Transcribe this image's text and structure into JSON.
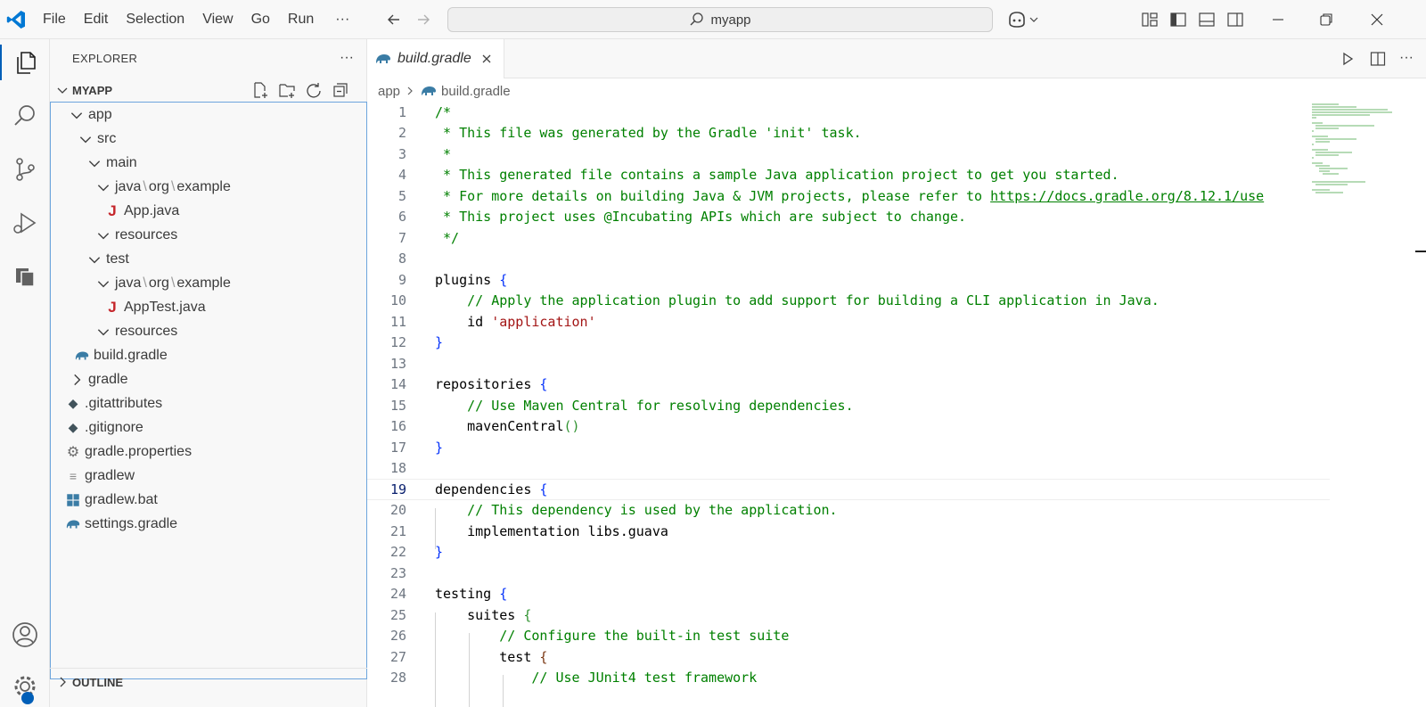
{
  "titlebar": {
    "menu": [
      "File",
      "Edit",
      "Selection",
      "View",
      "Go",
      "Run",
      "···"
    ],
    "search_text": "myapp",
    "icons": [
      "vscode-logo-icon",
      "arrow-left-icon",
      "arrow-right-icon",
      "search-icon",
      "copilot-icon",
      "customize-layout-icon",
      "toggle-sidebar-icon",
      "toggle-panel-icon",
      "toggle-secondary-sidebar-icon",
      "minimize-icon",
      "restore-icon",
      "close-icon"
    ],
    "accent": "#005fb8"
  },
  "activity_bar": {
    "items": [
      "explorer-icon",
      "search-icon",
      "source-control-icon",
      "run-debug-icon",
      "remote-explorer-icon",
      "accounts-icon",
      "manage-gear-icon"
    ]
  },
  "sidebar": {
    "title": "EXPLORER",
    "more": "···",
    "section": "MYAPP",
    "tree": [
      {
        "label": "app",
        "type": "folder-open"
      },
      {
        "label": "src",
        "type": "folder-open"
      },
      {
        "label": "main",
        "type": "folder-open"
      },
      {
        "label": "java",
        "label2": "org",
        "label3": "example",
        "type": "folder-open"
      },
      {
        "label": "App.java",
        "type": "java"
      },
      {
        "label": "resources",
        "type": "folder-open"
      },
      {
        "label": "test",
        "type": "folder-open"
      },
      {
        "label": "java",
        "label2": "org",
        "label3": "example",
        "type": "folder-open"
      },
      {
        "label": "AppTest.java",
        "type": "java"
      },
      {
        "label": "resources",
        "type": "folder-open"
      },
      {
        "label": "build.gradle",
        "type": "gradle"
      },
      {
        "label": "gradle",
        "type": "folder-closed"
      },
      {
        "label": ".gitattributes",
        "type": "git"
      },
      {
        "label": ".gitignore",
        "type": "git"
      },
      {
        "label": "gradle.properties",
        "type": "gear"
      },
      {
        "label": "gradlew",
        "type": "text"
      },
      {
        "label": "gradlew.bat",
        "type": "windows"
      },
      {
        "label": "settings.gradle",
        "type": "gradle"
      }
    ],
    "outline": "OUTLINE"
  },
  "editor": {
    "tab": "build.gradle",
    "breadcrumb": [
      "app",
      "build.gradle"
    ],
    "current_line": 19,
    "code": [
      {
        "n": "1",
        "t": "/*"
      },
      {
        "n": "2",
        "t": " * This file was generated by the Gradle 'init' task."
      },
      {
        "n": "3",
        "t": " *"
      },
      {
        "n": "4",
        "t": " * This generated file contains a sample Java application project to get you started."
      },
      {
        "n": "5",
        "t": " * For more details on building Java & JVM projects, please refer to ",
        "link": "https://docs.gradle.org/8.12.1/use"
      },
      {
        "n": "6",
        "t": " * This project uses @Incubating APIs which are subject to change."
      },
      {
        "n": "7",
        "t": " */"
      },
      {
        "n": "8",
        "t": ""
      },
      {
        "n": "9",
        "t": "plugins ",
        "b": "{"
      },
      {
        "n": "10",
        "t": "    // Apply the application plugin to add support for building a CLI application in Java."
      },
      {
        "n": "11",
        "t": "    id ",
        "s": "'application'"
      },
      {
        "n": "12",
        "t": "",
        "b": "}"
      },
      {
        "n": "13",
        "t": ""
      },
      {
        "n": "14",
        "t": "repositories ",
        "b": "{"
      },
      {
        "n": "15",
        "t": "    // Use Maven Central for resolving dependencies."
      },
      {
        "n": "16",
        "t": "    mavenCentral",
        "b2": "()"
      },
      {
        "n": "17",
        "t": "",
        "b": "}"
      },
      {
        "n": "18",
        "t": ""
      },
      {
        "n": "19",
        "t": "dependencies ",
        "b": "{"
      },
      {
        "n": "20",
        "t": "    // This dependency is used by the application."
      },
      {
        "n": "21",
        "t": "    implementation libs.guava"
      },
      {
        "n": "22",
        "t": "",
        "b": "}"
      },
      {
        "n": "23",
        "t": ""
      },
      {
        "n": "24",
        "t": "testing ",
        "b": "{"
      },
      {
        "n": "25",
        "t": "    suites ",
        "b2": "{"
      },
      {
        "n": "26",
        "t": "        // Configure the built-in test suite"
      },
      {
        "n": "27",
        "t": "        test ",
        "b3": "{"
      },
      {
        "n": "28",
        "t": "            // Use JUnit4 test framework"
      }
    ]
  }
}
